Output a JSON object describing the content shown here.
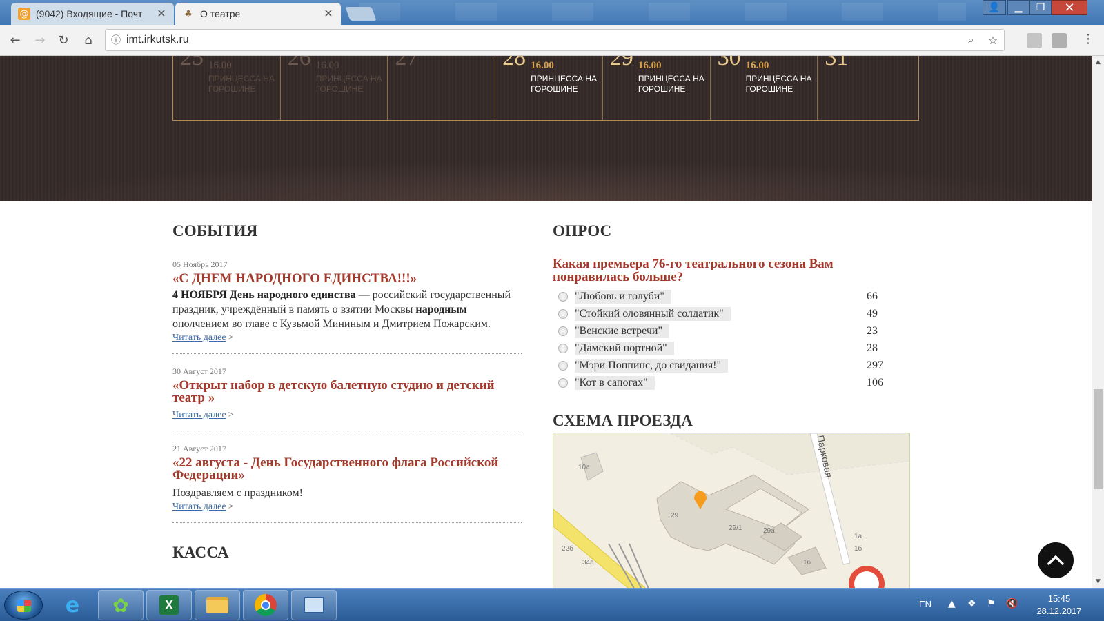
{
  "browser": {
    "tabs": [
      {
        "title": "(9042) Входящие - Почт",
        "favicon": "mail-at-icon",
        "active": false
      },
      {
        "title": "О театре",
        "favicon": "theater-icon",
        "active": true
      }
    ],
    "url": "imt.irkutsk.ru"
  },
  "calendar": {
    "cells": [
      {
        "day": "25",
        "time": "16.00",
        "title": "ПРИНЦЕССА НА ГОРОШИНЕ",
        "past": true
      },
      {
        "day": "26",
        "time": "16.00",
        "title": "ПРИНЦЕССА НА ГОРОШИНЕ",
        "past": true
      },
      {
        "day": "27",
        "time": "",
        "title": "",
        "past": true
      },
      {
        "day": "28",
        "time": "16.00",
        "title": "ПРИНЦЕССА НА ГОРОШИНЕ",
        "past": false
      },
      {
        "day": "29",
        "time": "16.00",
        "title": "ПРИНЦЕССА НА ГОРОШИНЕ",
        "past": false
      },
      {
        "day": "30",
        "time": "16.00",
        "title": "ПРИНЦЕССА НА ГОРОШИНЕ",
        "past": false
      },
      {
        "day": "31",
        "time": "",
        "title": "",
        "past": false
      }
    ]
  },
  "events": {
    "heading": "СОБЫТИЯ",
    "read_more": "Читать далее",
    "items": [
      {
        "date": "05 Ноябрь 2017",
        "title": "«С ДНЕМ НАРОДНОГО ЕДИНСТВА!!!»",
        "text_b1": "4 НОЯБРЯ День народного единства",
        "text_1": " — российский государственный праздник, учреждённый в память о взятии Москвы ",
        "text_b2": "народным",
        "text_2": " ополчением во главе с Кузьмой Мининым и Дмитрием Пожарским."
      },
      {
        "date": "30 Август 2017",
        "title": "«Открыт набор в детскую балетную студию и детский театр »"
      },
      {
        "date": "21 Август 2017",
        "title": "«22 августа - День Государственного флага Российской Федерации»",
        "text": "Поздравляем с праздником!"
      }
    ],
    "next_heading": "КАССА"
  },
  "poll": {
    "heading": "ОПРОС",
    "question": "Какая премьера 76-го театрального сезона Вам понравилась больше?",
    "options": [
      {
        "label": "\"Любовь и голуби\"",
        "votes": "66"
      },
      {
        "label": "\"Стойкий оловянный солдатик\"",
        "votes": "49"
      },
      {
        "label": "\"Венские встречи\"",
        "votes": "23"
      },
      {
        "label": "\"Дамский портной\"",
        "votes": "28"
      },
      {
        "label": "\"Мэри Поппинс, до свидания!\"",
        "votes": "297"
      },
      {
        "label": "\"Кот в сапогах\"",
        "votes": "106"
      }
    ]
  },
  "route": {
    "heading": "СХЕМА ПРОЕЗДА",
    "map_labels": {
      "street": "Парковая",
      "b1": "10а",
      "b2": "29",
      "b3": "29/1",
      "b4": "29а",
      "b5": "22б",
      "b6": "34а",
      "b7": "16",
      "b8": "1а",
      "b9": "1б"
    }
  },
  "taskbar": {
    "lang": "EN",
    "time": "15:45",
    "date": "28.12.2017"
  },
  "colors": {
    "accent_red": "#a2392b",
    "calendar_gold": "#d6a14a",
    "dark_band": "#3b2f2a"
  }
}
